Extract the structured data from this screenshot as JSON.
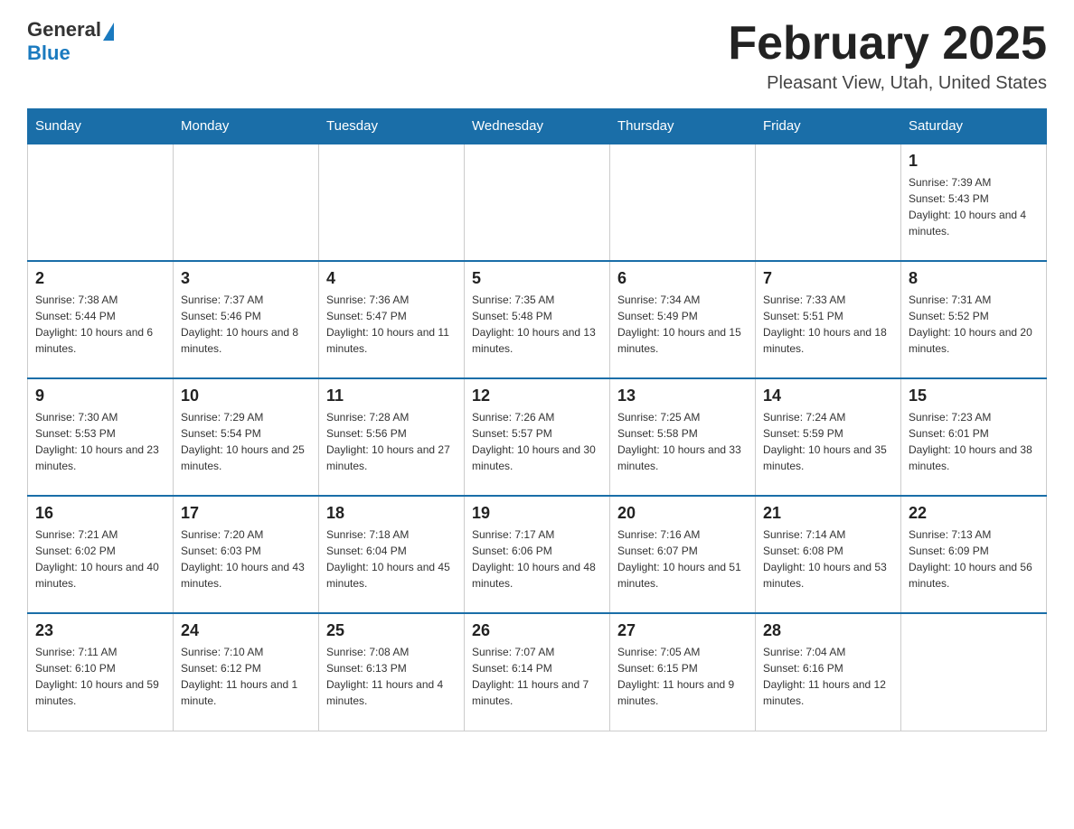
{
  "logo": {
    "general": "General",
    "blue": "Blue"
  },
  "header": {
    "month_title": "February 2025",
    "location": "Pleasant View, Utah, United States"
  },
  "days_of_week": [
    "Sunday",
    "Monday",
    "Tuesday",
    "Wednesday",
    "Thursday",
    "Friday",
    "Saturday"
  ],
  "weeks": [
    [
      {
        "day": "",
        "info": ""
      },
      {
        "day": "",
        "info": ""
      },
      {
        "day": "",
        "info": ""
      },
      {
        "day": "",
        "info": ""
      },
      {
        "day": "",
        "info": ""
      },
      {
        "day": "",
        "info": ""
      },
      {
        "day": "1",
        "info": "Sunrise: 7:39 AM\nSunset: 5:43 PM\nDaylight: 10 hours and 4 minutes."
      }
    ],
    [
      {
        "day": "2",
        "info": "Sunrise: 7:38 AM\nSunset: 5:44 PM\nDaylight: 10 hours and 6 minutes."
      },
      {
        "day": "3",
        "info": "Sunrise: 7:37 AM\nSunset: 5:46 PM\nDaylight: 10 hours and 8 minutes."
      },
      {
        "day": "4",
        "info": "Sunrise: 7:36 AM\nSunset: 5:47 PM\nDaylight: 10 hours and 11 minutes."
      },
      {
        "day": "5",
        "info": "Sunrise: 7:35 AM\nSunset: 5:48 PM\nDaylight: 10 hours and 13 minutes."
      },
      {
        "day": "6",
        "info": "Sunrise: 7:34 AM\nSunset: 5:49 PM\nDaylight: 10 hours and 15 minutes."
      },
      {
        "day": "7",
        "info": "Sunrise: 7:33 AM\nSunset: 5:51 PM\nDaylight: 10 hours and 18 minutes."
      },
      {
        "day": "8",
        "info": "Sunrise: 7:31 AM\nSunset: 5:52 PM\nDaylight: 10 hours and 20 minutes."
      }
    ],
    [
      {
        "day": "9",
        "info": "Sunrise: 7:30 AM\nSunset: 5:53 PM\nDaylight: 10 hours and 23 minutes."
      },
      {
        "day": "10",
        "info": "Sunrise: 7:29 AM\nSunset: 5:54 PM\nDaylight: 10 hours and 25 minutes."
      },
      {
        "day": "11",
        "info": "Sunrise: 7:28 AM\nSunset: 5:56 PM\nDaylight: 10 hours and 27 minutes."
      },
      {
        "day": "12",
        "info": "Sunrise: 7:26 AM\nSunset: 5:57 PM\nDaylight: 10 hours and 30 minutes."
      },
      {
        "day": "13",
        "info": "Sunrise: 7:25 AM\nSunset: 5:58 PM\nDaylight: 10 hours and 33 minutes."
      },
      {
        "day": "14",
        "info": "Sunrise: 7:24 AM\nSunset: 5:59 PM\nDaylight: 10 hours and 35 minutes."
      },
      {
        "day": "15",
        "info": "Sunrise: 7:23 AM\nSunset: 6:01 PM\nDaylight: 10 hours and 38 minutes."
      }
    ],
    [
      {
        "day": "16",
        "info": "Sunrise: 7:21 AM\nSunset: 6:02 PM\nDaylight: 10 hours and 40 minutes."
      },
      {
        "day": "17",
        "info": "Sunrise: 7:20 AM\nSunset: 6:03 PM\nDaylight: 10 hours and 43 minutes."
      },
      {
        "day": "18",
        "info": "Sunrise: 7:18 AM\nSunset: 6:04 PM\nDaylight: 10 hours and 45 minutes."
      },
      {
        "day": "19",
        "info": "Sunrise: 7:17 AM\nSunset: 6:06 PM\nDaylight: 10 hours and 48 minutes."
      },
      {
        "day": "20",
        "info": "Sunrise: 7:16 AM\nSunset: 6:07 PM\nDaylight: 10 hours and 51 minutes."
      },
      {
        "day": "21",
        "info": "Sunrise: 7:14 AM\nSunset: 6:08 PM\nDaylight: 10 hours and 53 minutes."
      },
      {
        "day": "22",
        "info": "Sunrise: 7:13 AM\nSunset: 6:09 PM\nDaylight: 10 hours and 56 minutes."
      }
    ],
    [
      {
        "day": "23",
        "info": "Sunrise: 7:11 AM\nSunset: 6:10 PM\nDaylight: 10 hours and 59 minutes."
      },
      {
        "day": "24",
        "info": "Sunrise: 7:10 AM\nSunset: 6:12 PM\nDaylight: 11 hours and 1 minute."
      },
      {
        "day": "25",
        "info": "Sunrise: 7:08 AM\nSunset: 6:13 PM\nDaylight: 11 hours and 4 minutes."
      },
      {
        "day": "26",
        "info": "Sunrise: 7:07 AM\nSunset: 6:14 PM\nDaylight: 11 hours and 7 minutes."
      },
      {
        "day": "27",
        "info": "Sunrise: 7:05 AM\nSunset: 6:15 PM\nDaylight: 11 hours and 9 minutes."
      },
      {
        "day": "28",
        "info": "Sunrise: 7:04 AM\nSunset: 6:16 PM\nDaylight: 11 hours and 12 minutes."
      },
      {
        "day": "",
        "info": ""
      }
    ]
  ]
}
